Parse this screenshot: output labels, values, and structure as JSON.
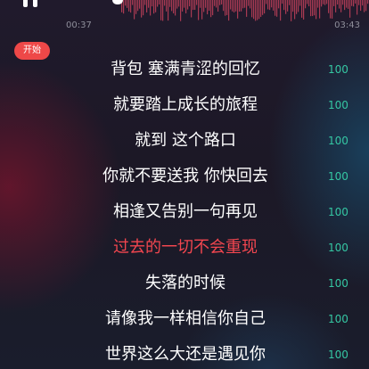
{
  "player": {
    "current_time": "00:37",
    "total_time": "03:43",
    "waveform_color": "#d64660"
  },
  "start_badge": "开始",
  "colors": {
    "current_line": "#f2464f",
    "score": "#35c7a3",
    "badge": "#ee4848"
  },
  "lyrics": [
    {
      "text": "背包 塞满青涩的回忆",
      "score": "100"
    },
    {
      "text": "就要踏上成长的旅程",
      "score": "100"
    },
    {
      "text": "就到 这个路口",
      "score": "100"
    },
    {
      "text": "你就不要送我 你快回去",
      "score": "100"
    },
    {
      "text": "相逢又告别一句再见",
      "score": "100"
    },
    {
      "text": "过去的一切不会重现",
      "score": "100"
    },
    {
      "text": "失落的时候",
      "score": "100"
    },
    {
      "text": "请像我一样相信你自己",
      "score": "100"
    },
    {
      "text": "世界这么大还是遇见你",
      "score": "100"
    }
  ]
}
